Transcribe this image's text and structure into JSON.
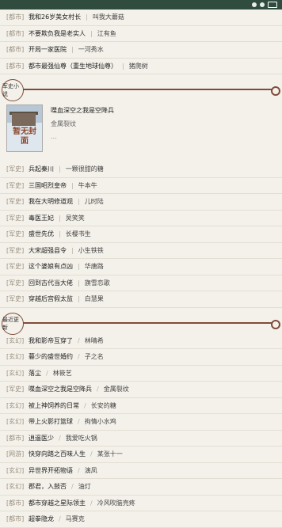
{
  "statusbar": {
    "icons": [
      "signal-icon",
      "wifi-icon",
      "battery-icon"
    ]
  },
  "top_list": [
    {
      "cat": "[都市]",
      "title": "我和26岁美女村长",
      "author": "叫我大蘑菇"
    },
    {
      "cat": "[都市]",
      "title": "不要欺负我是老实人",
      "author": "江有鱼"
    },
    {
      "cat": "[都市]",
      "title": "开局一家医院",
      "author": "一河秀水"
    },
    {
      "cat": "[都市]",
      "title": "都市最强仙尊（重生地球仙尊）",
      "author": "猪爬树"
    }
  ],
  "section_military": {
    "label": "军史小说",
    "featured": {
      "title": "喋血深空之我是空降兵",
      "author": "金属裂纹",
      "excerpt": "...",
      "cover_text": "暂无封面"
    },
    "list": [
      {
        "cat": "[军史]",
        "title": "兵起秦川",
        "author": "一颗很甜的糖"
      },
      {
        "cat": "[军史]",
        "title": "三国昭烈皇帝",
        "author": "牛本牛"
      },
      {
        "cat": "[军史]",
        "title": "我在大明修道观",
        "author": "儿时陆"
      },
      {
        "cat": "[军史]",
        "title": "毒医王妃",
        "author": "吴笑笑"
      },
      {
        "cat": "[军史]",
        "title": "盛世先优",
        "author": "长樱书生"
      },
      {
        "cat": "[军史]",
        "title": "大宋超强县令",
        "author": "小生铁铁"
      },
      {
        "cat": "[军史]",
        "title": "这个婆娘有点凶",
        "author": "华唐路"
      },
      {
        "cat": "[军史]",
        "title": "回到古代当大佬",
        "author": "旗雪恋歌"
      },
      {
        "cat": "[军史]",
        "title": "穿越后宫假太监",
        "author": "白慧果"
      }
    ]
  },
  "section_recent": {
    "label": "最近更新",
    "list": [
      {
        "cat": "[玄幻]",
        "title": "我和影帝互穿了",
        "author": "林晴希"
      },
      {
        "cat": "[玄幻]",
        "title": "暮少的盛世婚约",
        "author": "子之名"
      },
      {
        "cat": "[玄幻]",
        "title": "落尘",
        "author": "林筱艺"
      },
      {
        "cat": "[军史]",
        "title": "喋血深空之我是空降兵",
        "author": "金属裂纹"
      },
      {
        "cat": "[玄幻]",
        "title": "被上神饲养的日常",
        "author": "长安的糖"
      },
      {
        "cat": "[玄幻]",
        "title": "带上火影打篮球",
        "author": "拘情小水鸡"
      },
      {
        "cat": "[都市]",
        "title": "逍遥医少",
        "author": "我爱吃火锅"
      },
      {
        "cat": "[网游]",
        "title": "快穿向踏之百味人生",
        "author": "某张十一"
      },
      {
        "cat": "[玄幻]",
        "title": "异世界开拓物语",
        "author": "演凤"
      },
      {
        "cat": "[玄幻]",
        "title": "郡君，入鼓否",
        "author": "油灯"
      },
      {
        "cat": "[都市]",
        "title": "都市穿越之星际领主",
        "author": "冷风吹脑壳疼"
      },
      {
        "cat": "[都市]",
        "title": "超拳隐龙",
        "author": "马赛克"
      }
    ]
  },
  "colors": {
    "statusbar": "#2f4c3f",
    "accent": "#7f4b3a",
    "background": "#f4f1ea"
  }
}
